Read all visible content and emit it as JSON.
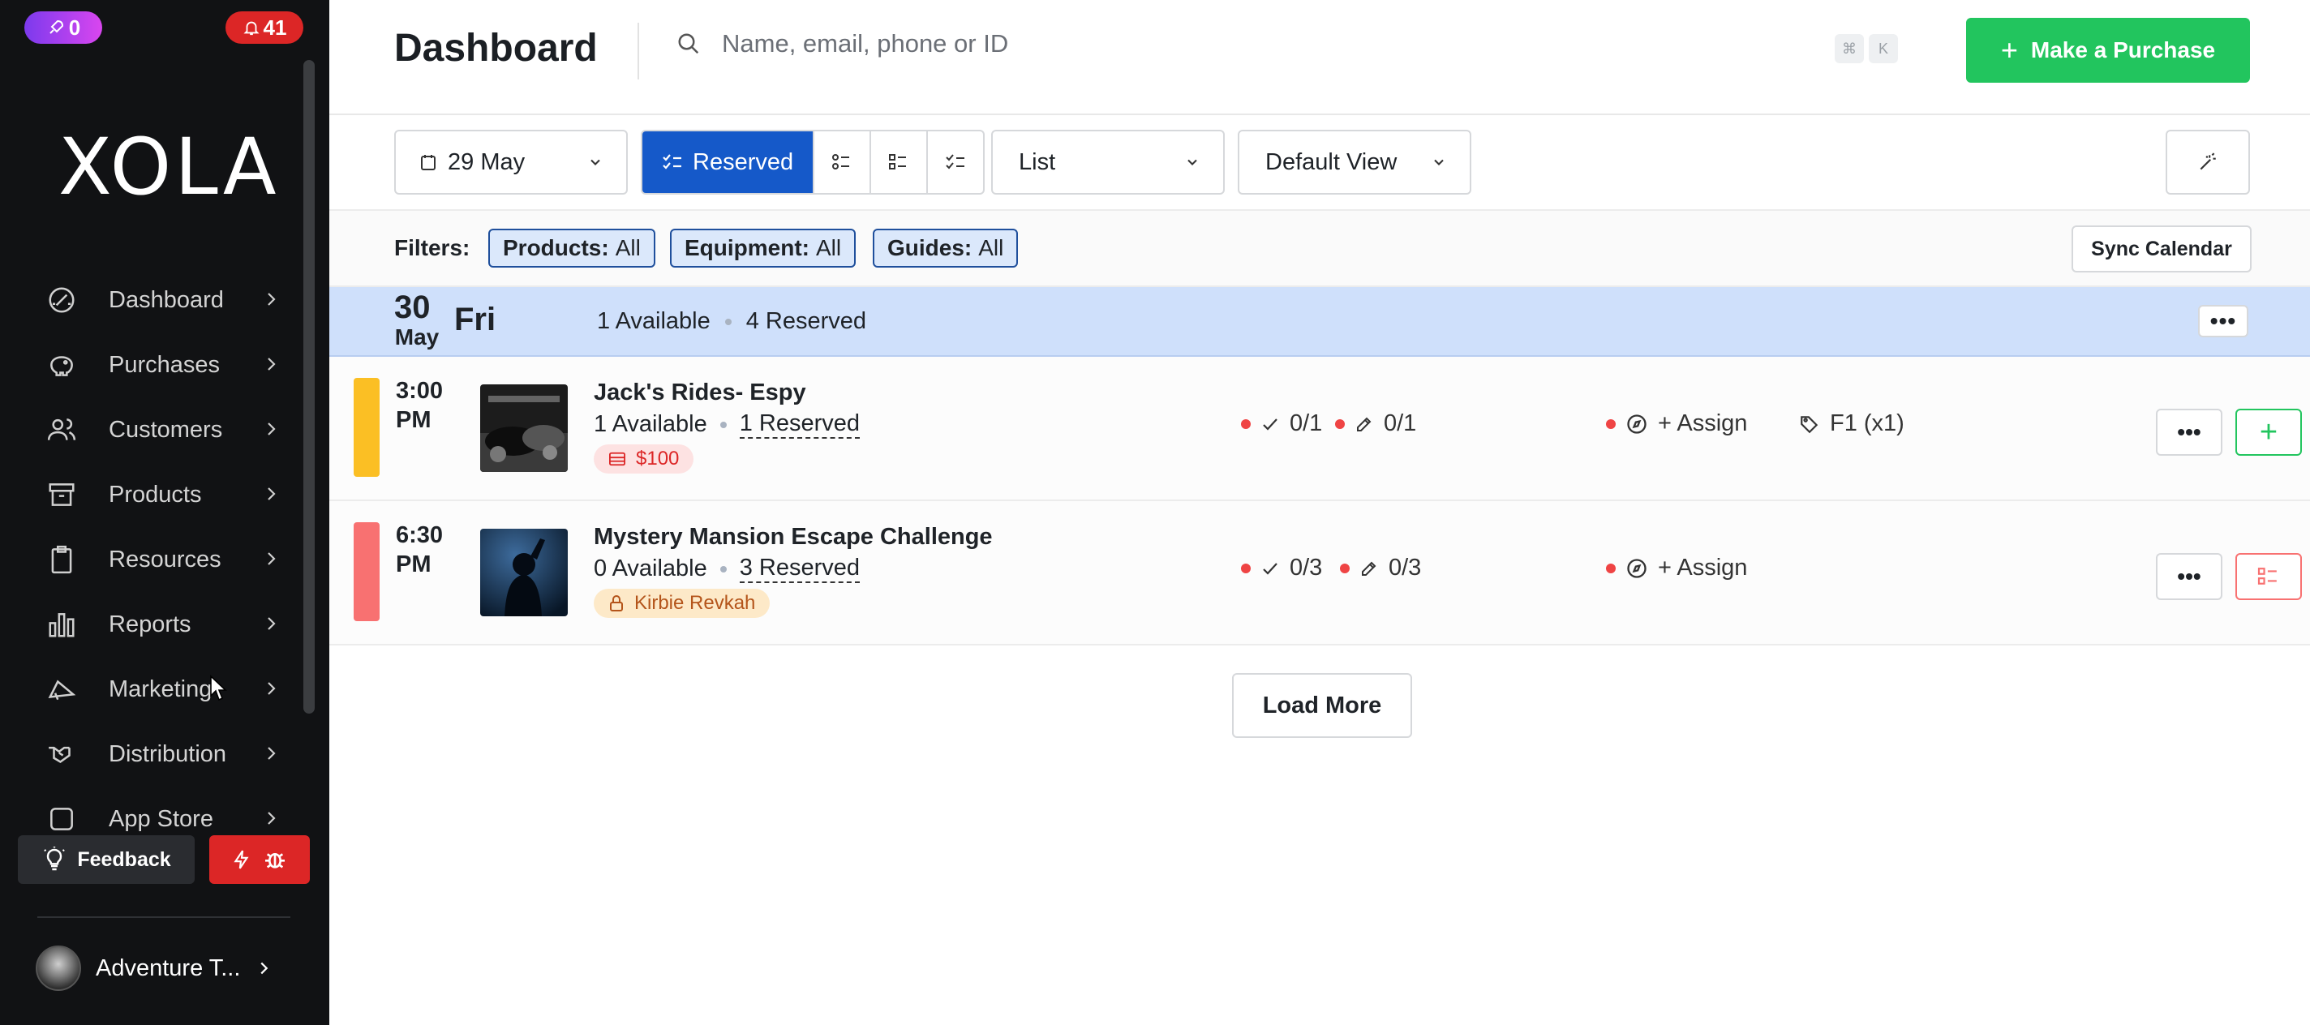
{
  "sidebar": {
    "upgrade_badge": "0",
    "notifications_badge": "41",
    "logo": "XOLA",
    "items": [
      {
        "label": "Dashboard",
        "icon": "gauge-icon"
      },
      {
        "label": "Purchases",
        "icon": "piggy-bank-icon"
      },
      {
        "label": "Customers",
        "icon": "users-icon"
      },
      {
        "label": "Products",
        "icon": "archive-icon"
      },
      {
        "label": "Resources",
        "icon": "clipboard-icon"
      },
      {
        "label": "Reports",
        "icon": "bar-chart-icon"
      },
      {
        "label": "Marketing",
        "icon": "megaphone-icon"
      },
      {
        "label": "Distribution",
        "icon": "handshake-icon"
      },
      {
        "label": "App Store",
        "icon": "square-icon"
      }
    ],
    "feedback_label": "Feedback",
    "account_name": "Adventure T..."
  },
  "header": {
    "title": "Dashboard",
    "search_placeholder": "Name, email, phone or ID",
    "shortcut_keys": [
      "⌘",
      "K"
    ],
    "purchase_button": "Make a Purchase"
  },
  "toolbar": {
    "date": "29 May",
    "active_view": "Reserved",
    "layout": "List",
    "saved_view": "Default View"
  },
  "filters": {
    "label": "Filters:",
    "chips": [
      {
        "key": "Products:",
        "value": "All"
      },
      {
        "key": "Equipment:",
        "value": "All"
      },
      {
        "key": "Guides:",
        "value": "All"
      }
    ],
    "sync_button": "Sync Calendar"
  },
  "day": {
    "date_num": "30",
    "month": "May",
    "weekday": "Fri",
    "available": "1 Available",
    "reserved": "4 Reserved"
  },
  "events": [
    {
      "time_line1": "3:00",
      "time_line2": "PM",
      "color": "#fbbf24",
      "name": "Jack's Rides- Espy",
      "available": "1 Available",
      "reserved": "1 Reserved",
      "tag": "$100",
      "tag_type": "price",
      "checkin": "0/1",
      "waiver": "0/1",
      "assign": "+ Assign",
      "equipment": "F1 (x1)"
    },
    {
      "time_line1": "6:30",
      "time_line2": "PM",
      "color": "#f87171",
      "name": "Mystery Mansion Escape Challenge",
      "available": "0 Available",
      "reserved": "3 Reserved",
      "tag": "Kirbie Revkah",
      "tag_type": "lock",
      "checkin": "0/3",
      "waiver": "0/3",
      "assign": "+ Assign",
      "equipment": ""
    }
  ],
  "load_more": "Load More",
  "colors": {
    "accent_green": "#22c55e",
    "accent_blue": "#1559c9",
    "day_header": "#cfe0fb",
    "sidebar_bg": "#111214"
  }
}
